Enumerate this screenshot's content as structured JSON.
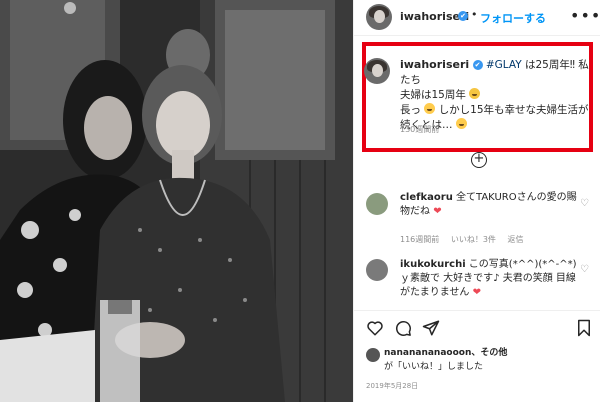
{
  "header": {
    "username": "iwahoriseri",
    "verified_mark": "✔",
    "separator": "•",
    "follow_label": "フォローする",
    "more_label": "•••"
  },
  "caption": {
    "username": "iwahoriseri",
    "verified_mark": "✔",
    "hashtag": "#GLAY",
    "line1_rest": " は25周年‼ 私たち",
    "line2": "夫婦は15周年",
    "line3a": "長っ",
    "line3b": "しかし15年も幸せな夫婦生活が",
    "line4": "続くとは…",
    "timestamp": "130週間前"
  },
  "plus_label": "+",
  "comments": [
    {
      "username": "clefkaoru",
      "text": " 全てTAKUROさんの愛の賜物だね",
      "heart": "❤",
      "meta": {
        "time": "116週間前",
        "likes": "いいね！3件",
        "reply": "返信"
      }
    },
    {
      "username": "ikukokurchi",
      "text": " この写真(*^^)(*^-^*) ｙ素敵で 大好きです♪ 夫君の笑顔 目線がたまりません",
      "heart": "❤"
    }
  ],
  "comment_like_icon": "♡",
  "liked_by": {
    "user": "nananananaooon",
    "rest": "、その他",
    "line2": "が「いいね！」しました"
  },
  "post_date": "2019年5月28日",
  "icons": {
    "like": "heart-outline-icon",
    "comment": "comment-bubble-icon",
    "share": "paper-plane-icon",
    "save": "bookmark-icon"
  },
  "colors": {
    "highlight_border": "#e60012",
    "link_blue": "#0095f6",
    "verified_blue": "#3897f0",
    "heart_red": "#ed4956"
  }
}
